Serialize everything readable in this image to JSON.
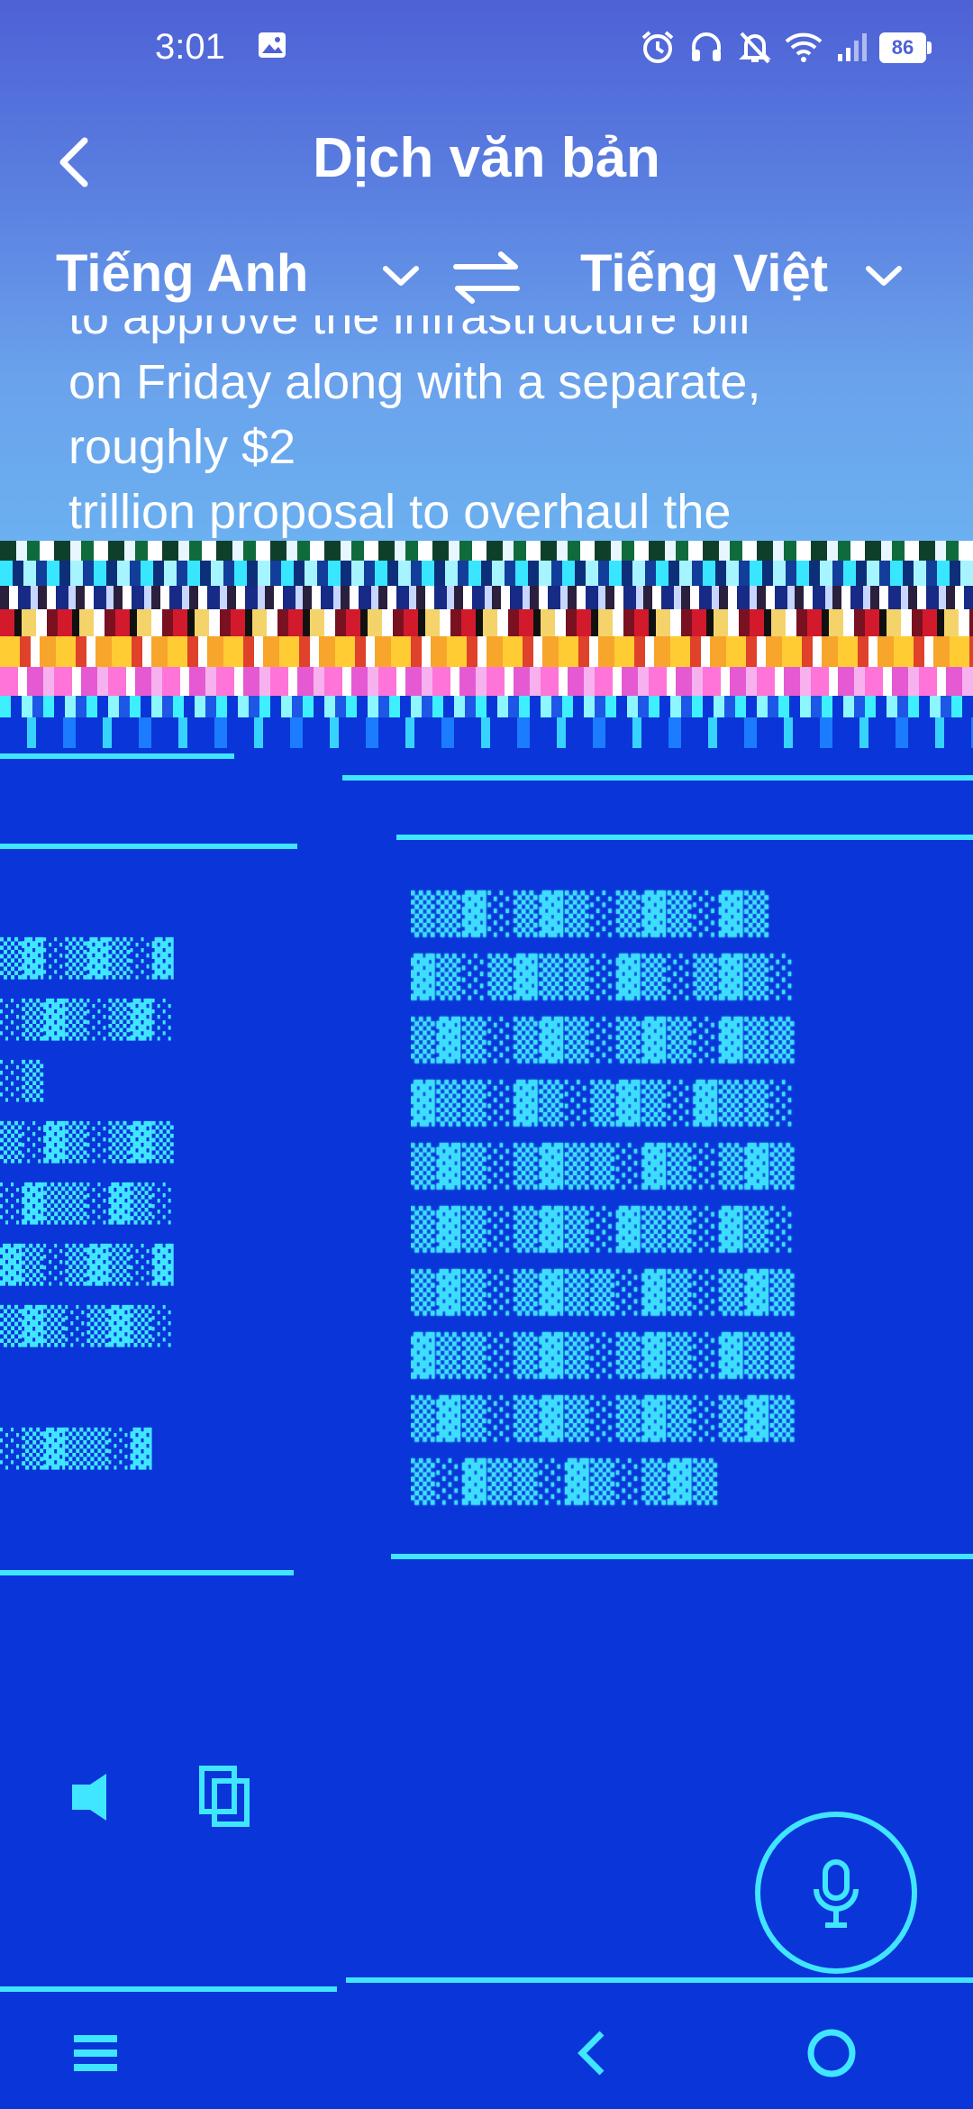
{
  "status_bar": {
    "time": "3:01",
    "battery": "86",
    "icons": [
      "image-icon",
      "alarm-icon",
      "headphones-icon",
      "bell-off-icon",
      "wifi-icon",
      "signal-icon",
      "battery-icon"
    ]
  },
  "header": {
    "title": "Dịch văn bản",
    "back_icon": "chevron-left-icon"
  },
  "languages": {
    "source": "Tiếng Anh",
    "target": "Tiếng Việt",
    "swap_icon": "swap-icon"
  },
  "source_text": {
    "lines": [
      "to approve the infrastructure bill",
      "on Friday along with a separate,",
      "roughly $2",
      "trillion proposal to overhaul the"
    ]
  },
  "colors": {
    "gradient_top": "#4e61d6",
    "gradient_bottom": "#6bb0f0",
    "corrupted_bg": "#0a35d8",
    "corrupted_fg": "#40e6ff"
  },
  "mic": {
    "icon": "microphone-icon"
  },
  "nav_bar": {
    "icons": [
      "recents-icon",
      "back-icon",
      "home-icon"
    ]
  }
}
